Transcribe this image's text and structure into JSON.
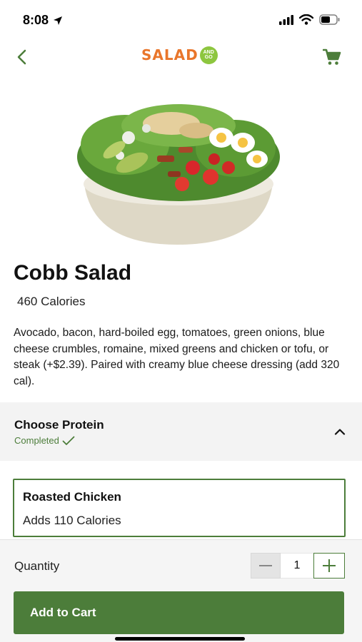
{
  "status_bar": {
    "time": "8:08",
    "icons": [
      "location-arrow-icon",
      "cellular-signal-icon",
      "wifi-icon",
      "battery-icon"
    ]
  },
  "nav": {
    "back_icon": "chevron-left-icon",
    "logo_text": "SALAD",
    "logo_badge_line1": "AND",
    "logo_badge_line2": "GO",
    "cart_icon": "shopping-cart-icon"
  },
  "product": {
    "name": "Cobb Salad",
    "calories": "460 Calories",
    "description": "Avocado, bacon, hard-boiled egg, tomatoes, green onions, blue cheese crumbles, romaine, mixed greens and chicken or tofu, or steak (+$2.39). Paired with creamy blue cheese dressing (add 320 cal)."
  },
  "protein": {
    "title": "Choose Protein",
    "status": "Completed",
    "selected_option": {
      "name": "Roasted Chicken",
      "calories": "Adds 110 Calories"
    }
  },
  "order": {
    "quantity_label": "Quantity",
    "quantity": "1",
    "add_button_label": "Add to Cart"
  },
  "colors": {
    "brand_green": "#4c7d3a",
    "logo_orange": "#e9762b",
    "logo_lime": "#8dc63f",
    "panel_gray": "#f3f3f3"
  }
}
